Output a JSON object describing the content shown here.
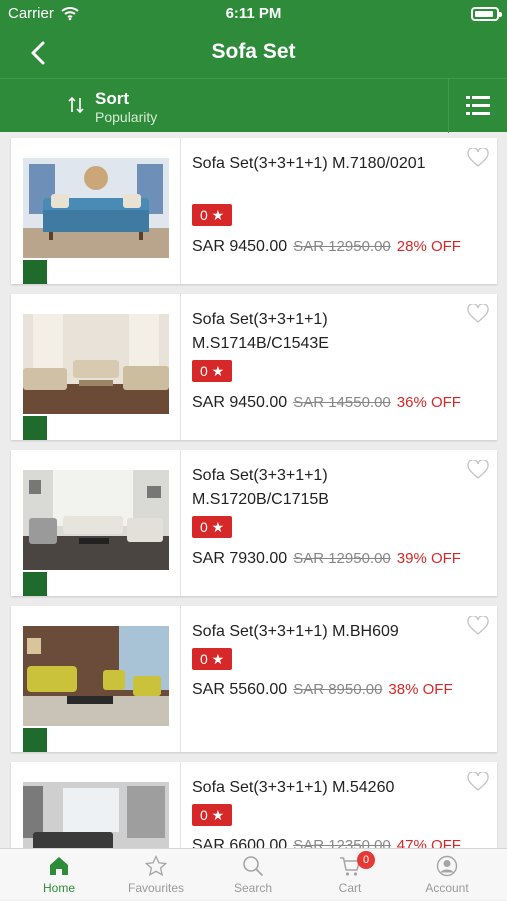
{
  "status_bar": {
    "carrier": "Carrier",
    "time": "6:11 PM"
  },
  "nav": {
    "title": "Sofa Set"
  },
  "sort": {
    "label": "Sort",
    "value": "Popularity"
  },
  "products": [
    {
      "name": "Sofa Set(3+3+1+1) M.7180/0201",
      "rating": "0 ★",
      "price": "SAR 9450.00",
      "old_price": "SAR 12950.00",
      "discount": "28% OFF"
    },
    {
      "name": "Sofa Set(3+3+1+1) M.S1714B/C1543E",
      "rating": "0 ★",
      "price": "SAR 9450.00",
      "old_price": "SAR 14550.00",
      "discount": "36% OFF"
    },
    {
      "name": "Sofa Set(3+3+1+1) M.S1720B/C1715B",
      "rating": "0 ★",
      "price": "SAR 7930.00",
      "old_price": "SAR 12950.00",
      "discount": "39% OFF"
    },
    {
      "name": "Sofa Set(3+3+1+1) M.BH609",
      "rating": "0 ★",
      "price": "SAR 5560.00",
      "old_price": "SAR 8950.00",
      "discount": "38% OFF"
    },
    {
      "name": "Sofa Set(3+3+1+1) M.54260",
      "rating": "0 ★",
      "price": "SAR 6600.00",
      "old_price": "SAR 12350.00",
      "discount": "47% OFF"
    }
  ],
  "tabs": [
    {
      "label": "Home",
      "icon": "home-icon"
    },
    {
      "label": "Favourites",
      "icon": "star-icon"
    },
    {
      "label": "Search",
      "icon": "search-icon"
    },
    {
      "label": "Cart",
      "icon": "cart-icon",
      "count": "0"
    },
    {
      "label": "Account",
      "icon": "account-icon"
    }
  ],
  "colors": {
    "brand_green": "#2e8b3a",
    "discount_red": "#d62828",
    "rating_red": "#d62828",
    "tab_inactive": "#9a9a9a"
  }
}
